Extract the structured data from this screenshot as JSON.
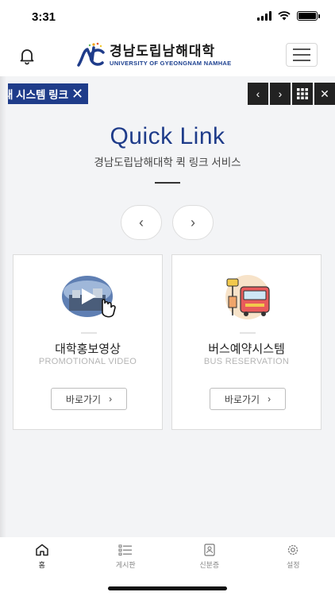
{
  "status_bar": {
    "time": "3:31"
  },
  "header": {
    "logo_text_ko": "경남도립남해대학",
    "logo_text_en": "UNIVERSITY OF GYEONGNAM NAMHAE",
    "brand_color": "#1f3c8a"
  },
  "link_strip": {
    "tag_text": "대 시스템 링크",
    "close_glyph": "✕",
    "controls": [
      "‹",
      "›",
      "grid",
      "✕"
    ]
  },
  "quick_link": {
    "title": "Quick Link",
    "subtitle": "경남도립남해대학 퀵 링크 서비스",
    "prev_glyph": "‹",
    "next_glyph": "›"
  },
  "cards": [
    {
      "name": "대학홍보영상",
      "en": "PROMOTIONAL VIDEO",
      "button": "바로가기",
      "arrow": "›",
      "icon": "video-play-icon"
    },
    {
      "name": "버스예약시스템",
      "en": "BUS RESERVATION",
      "button": "바로가기",
      "arrow": "›",
      "icon": "bus-icon"
    }
  ],
  "tabbar": {
    "items": [
      {
        "label": "홈",
        "icon": "home-icon",
        "active": true
      },
      {
        "label": "게시판",
        "icon": "list-icon",
        "active": false
      },
      {
        "label": "신분증",
        "icon": "id-card-icon",
        "active": false
      },
      {
        "label": "설정",
        "icon": "gear-icon",
        "active": false
      }
    ]
  }
}
